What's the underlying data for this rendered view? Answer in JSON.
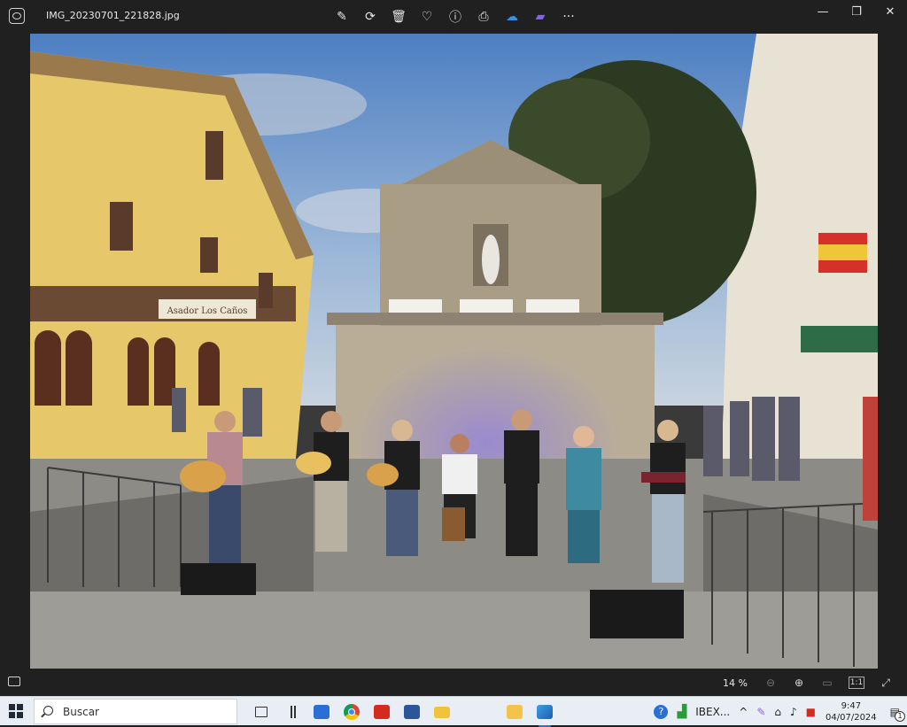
{
  "window": {
    "filename": "IMG_20230701_221828.jpg",
    "minimize": "—",
    "maximize": "❐",
    "close": "✕"
  },
  "toolbar": {
    "edit": "✎",
    "rotate": "⟳",
    "delete": "🗑",
    "favorite": "♡",
    "info": "ⓘ",
    "print": "⎙",
    "onedrive": "☁",
    "clipchamp": "▰",
    "more": "···"
  },
  "zoom": {
    "level": "14 %",
    "zoom_out": "⊖",
    "zoom_in": "⊕",
    "fit": "▭",
    "actual": "1:1",
    "fullscreen": "⤢"
  },
  "photo": {
    "restaurant_sign": "Asador Los Caños"
  },
  "taskbar": {
    "search_placeholder": "Buscar",
    "tray_stock": "IBEX...",
    "tray_up": "^",
    "time": "9:47",
    "date": "04/07/2024",
    "notifications": "1"
  },
  "colors": {
    "dark_bg": "#202020",
    "taskbar_bg": "#e9eef4",
    "accent": "#2a6fd6"
  }
}
